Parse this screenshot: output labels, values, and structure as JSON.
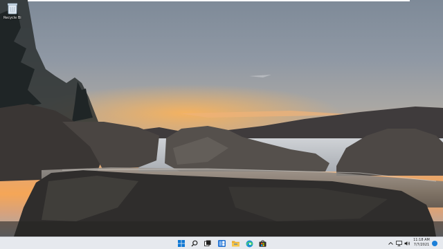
{
  "desktop": {
    "icons": [
      {
        "label": "Recycle Bi",
        "icon": "recycle-bin-icon"
      }
    ]
  },
  "taskbar": {
    "pinned": [
      {
        "name": "start-button",
        "icon": "windows-logo-icon"
      },
      {
        "name": "search-button",
        "icon": "search-icon"
      },
      {
        "name": "task-view-button",
        "icon": "task-view-icon"
      },
      {
        "name": "widgets-button",
        "icon": "widgets-icon"
      },
      {
        "name": "file-explorer-button",
        "icon": "folder-icon"
      },
      {
        "name": "edge-button",
        "icon": "edge-browser-icon"
      },
      {
        "name": "store-button",
        "icon": "store-icon"
      }
    ],
    "tray": {
      "icons": [
        "chevron-up-icon",
        "network-icon",
        "volume-icon"
      ]
    },
    "clock": {
      "time": "11:18 AM",
      "date": "7/7/2021"
    },
    "colors": {
      "taskbar_bg": "#e6e9ee",
      "accent": "#1c7fd8"
    }
  }
}
